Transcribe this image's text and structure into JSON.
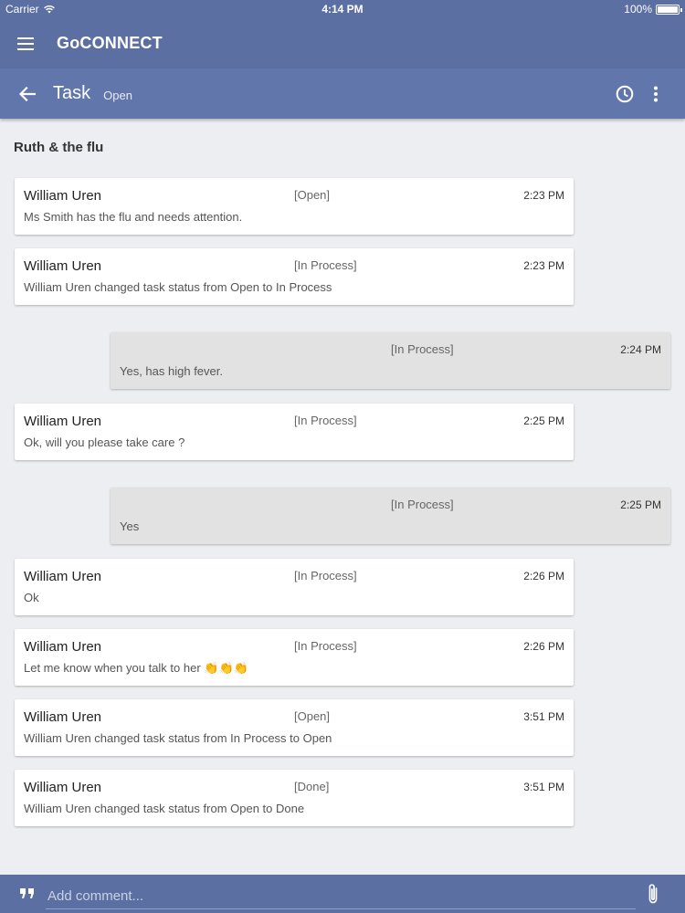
{
  "status_bar": {
    "carrier": "Carrier",
    "time": "4:14 PM",
    "battery": "100%"
  },
  "app_bar": {
    "title": "GoCONNECT",
    "menu_icon": "hamburger-menu-icon"
  },
  "task_bar": {
    "title": "Task",
    "status": "Open",
    "back_icon": "arrow-back-icon",
    "history_icon": "clock-icon",
    "more_icon": "more-vertical-icon"
  },
  "thread": {
    "title": "Ruth & the flu",
    "messages": [
      {
        "side": "left",
        "author": "William Uren",
        "status": "[Open]",
        "time": "2:23 PM",
        "text": "Ms Smith has the flu and needs attention."
      },
      {
        "side": "left",
        "author": "William Uren",
        "status": "[In Process]",
        "time": "2:23 PM",
        "text": "William Uren changed task status from Open to In Process"
      },
      {
        "side": "right",
        "author": "",
        "status": "[In Process]",
        "time": "2:24 PM",
        "text": "Yes, has high fever."
      },
      {
        "side": "left",
        "author": "William Uren",
        "status": "[In Process]",
        "time": "2:25 PM",
        "text": "Ok, will you please take care ?"
      },
      {
        "side": "right",
        "author": "",
        "status": "[In Process]",
        "time": "2:25 PM",
        "text": "Yes"
      },
      {
        "side": "left",
        "author": "William Uren",
        "status": "[In Process]",
        "time": "2:26 PM",
        "text": "Ok"
      },
      {
        "side": "left",
        "author": "William Uren",
        "status": "[In Process]",
        "time": "2:26 PM",
        "text": "Let me know when you talk to her 👏👏👏"
      },
      {
        "side": "left",
        "author": "William Uren",
        "status": "[Open]",
        "time": "3:51 PM",
        "text": "William Uren changed task status from In Process to Open"
      },
      {
        "side": "left",
        "author": "William Uren",
        "status": "[Done]",
        "time": "3:51 PM",
        "text": "William Uren changed task status from Open to Done"
      }
    ]
  },
  "comment_bar": {
    "placeholder": "Add comment...",
    "quote_icon": "quote-icon",
    "attach_icon": "paperclip-icon"
  },
  "colors": {
    "primary": "#5c6fa3",
    "background": "#eceef1",
    "own_message": "#e2e2e2"
  }
}
